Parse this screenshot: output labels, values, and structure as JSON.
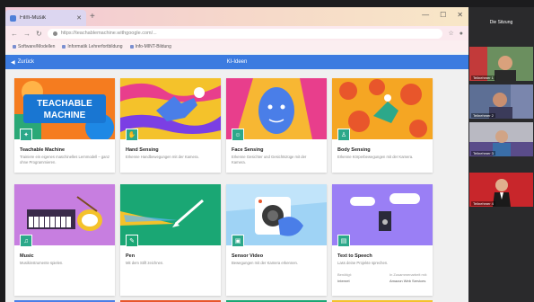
{
  "browser": {
    "tab_title": "Film-Musik",
    "url": "https://teachablemachine.withgoogle.com/...",
    "bookmarks": [
      "Software/Modellen",
      "Informatik Lehrerfortbildung",
      "Info-MINT-Bildung"
    ]
  },
  "app": {
    "back_label": "Zurück",
    "page_title": "KI-Ideen",
    "row1": [
      {
        "title": "Teachable Machine",
        "desc": "Trainiere ein eigenes maschinelles Lernmodell – ganz ohne Programmieren.",
        "art": "teachable",
        "badge_color": "#2ca88a"
      },
      {
        "title": "Hand Sensing",
        "desc": "Erkenne Handbewegungen mit der Kamera.",
        "art": "hand",
        "badge_color": "#2ca88a"
      },
      {
        "title": "Face Sensing",
        "desc": "Erkenne Gesichter und Gesichtszüge mit der Kamera.",
        "art": "face",
        "badge_color": "#2ca88a"
      },
      {
        "title": "Body Sensing",
        "desc": "Erkenne Körperbewegungen mit der Kamera.",
        "art": "body",
        "badge_color": "#2ca88a"
      }
    ],
    "row2": [
      {
        "title": "Music",
        "desc": "Musikinstrumente spielen.",
        "art": "music",
        "badge_color": "#2ca88a"
      },
      {
        "title": "Pen",
        "desc": "Mit dem Stift zeichnen.",
        "art": "pen",
        "badge_color": "#1aa774"
      },
      {
        "title": "Sensor Video",
        "desc": "Bewegungen mit der Kamera erkennen.",
        "art": "video",
        "badge_color": "#2ca88a"
      },
      {
        "title": "Text to Speech",
        "desc": "Lass deine Projekte sprechen.",
        "art": "tts",
        "badge_color": "#2ca88a",
        "meta": {
          "left_label": "Benötigt:",
          "left_val": "Internet",
          "right_label": "In Zusammenarbeit mit:",
          "right_val": "Amazon Web Services"
        }
      }
    ]
  },
  "meeting": {
    "header": "Die Sitzung",
    "participants": [
      {
        "name": "Teilnehmer 1",
        "bg": "#7a9a6a"
      },
      {
        "name": "Teilnehmer 2",
        "bg": "#6e7fa8"
      },
      {
        "name": "Teilnehmer 3",
        "bg": "#a7a7b0"
      },
      {
        "name": "Teilnehmer 4",
        "bg": "#c8262b"
      }
    ]
  },
  "colors": {
    "accent": "#3b7be0",
    "card_bg": "#ffffff"
  }
}
